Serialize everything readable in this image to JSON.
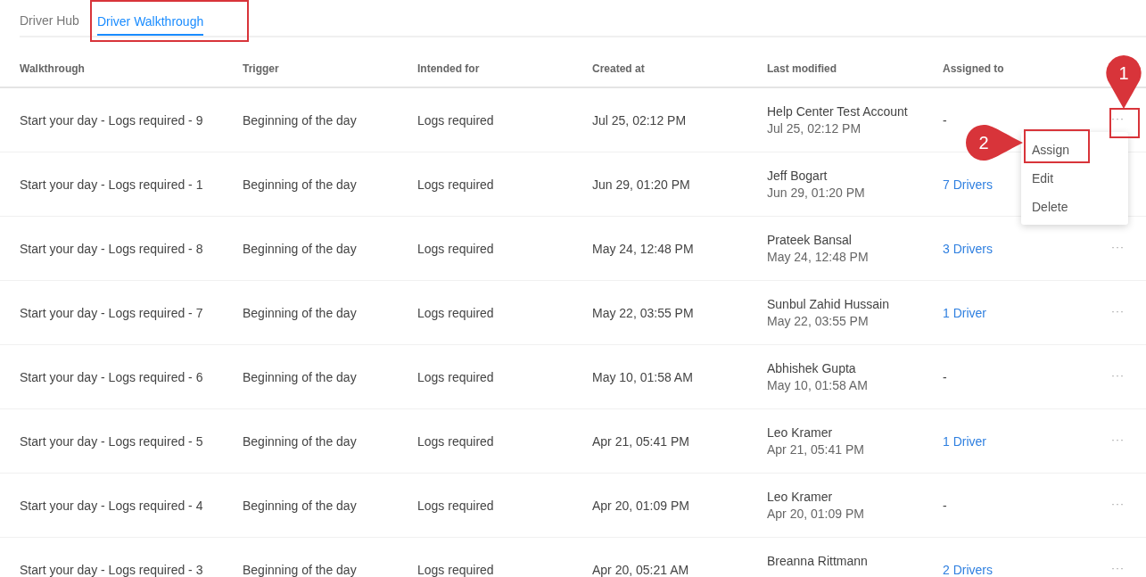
{
  "tabs": [
    {
      "label": "Driver Hub",
      "selected": false
    },
    {
      "label": "Driver Walkthrough",
      "selected": true
    }
  ],
  "table": {
    "columns": [
      "Walkthrough",
      "Trigger",
      "Intended for",
      "Created at",
      "Last modified",
      "Assigned to"
    ],
    "rows": [
      {
        "walkthrough": "Start your day - Logs required - 9",
        "trigger": "Beginning of the day",
        "intended_for": "Logs required",
        "created_at": "Jul 25, 02:12 PM",
        "modified_by": "Help Center Test Account",
        "modified_at": "Jul 25, 02:12 PM",
        "assigned": {
          "kind": "plain",
          "text": "-"
        },
        "actions": "···",
        "menu_open": true
      },
      {
        "walkthrough": "Start your day - Logs required - 1",
        "trigger": "Beginning of the day",
        "intended_for": "Logs required",
        "created_at": "Jun 29, 01:20 PM",
        "modified_by": "Jeff Bogart",
        "modified_at": "Jun 29, 01:20 PM",
        "assigned": {
          "kind": "link",
          "text": "7 Drivers"
        },
        "menu_open": false
      },
      {
        "walkthrough": "Start your day - Logs required - 8",
        "trigger": "Beginning of the day",
        "intended_for": "Logs required",
        "created_at": "May 24, 12:48 PM",
        "modified_by": "Prateek Bansal",
        "modified_at": "May 24, 12:48 PM",
        "assigned": {
          "kind": "link",
          "text": "3 Drivers"
        },
        "actions": "···",
        "menu_open": false
      },
      {
        "walkthrough": "Start your day - Logs required - 7",
        "trigger": "Beginning of the day",
        "intended_for": "Logs required",
        "created_at": "May 22, 03:55 PM",
        "modified_by": "Sunbul Zahid Hussain",
        "modified_at": "May 22, 03:55 PM",
        "assigned": {
          "kind": "link",
          "text": "1 Driver"
        },
        "actions": "···",
        "menu_open": false
      },
      {
        "walkthrough": "Start your day - Logs required - 6",
        "trigger": "Beginning of the day",
        "intended_for": "Logs required",
        "created_at": "May 10, 01:58 AM",
        "modified_by": "Abhishek Gupta",
        "modified_at": "May 10, 01:58 AM",
        "assigned": {
          "kind": "plain",
          "text": "-"
        },
        "actions": "···",
        "menu_open": false
      },
      {
        "walkthrough": "Start your day - Logs required - 5",
        "trigger": "Beginning of the day",
        "intended_for": "Logs required",
        "created_at": "Apr 21, 05:41 PM",
        "modified_by": "Leo Kramer",
        "modified_at": "Apr 21, 05:41 PM",
        "assigned": {
          "kind": "link",
          "text": "1 Driver"
        },
        "actions": "···",
        "menu_open": false
      },
      {
        "walkthrough": "Start your day - Logs required - 4",
        "trigger": "Beginning of the day",
        "intended_for": "Logs required",
        "created_at": "Apr 20, 01:09 PM",
        "modified_by": "Leo Kramer",
        "modified_at": "Apr 20, 01:09 PM",
        "assigned": {
          "kind": "plain",
          "text": "-"
        },
        "actions": "···",
        "menu_open": false
      },
      {
        "walkthrough": "Start your day - Logs required - 3",
        "trigger": "Beginning of the day",
        "intended_for": "Logs required",
        "created_at": "Apr 20, 05:21 AM",
        "modified_by": "Breanna Rittmann",
        "assigned": {
          "kind": "link",
          "text": "2 Drivers"
        },
        "actions": "···",
        "menu_open": false
      }
    ]
  },
  "row_menu": {
    "items": [
      {
        "label": "Assign",
        "highlighted": true
      },
      {
        "label": "Edit",
        "highlighted": false
      },
      {
        "label": "Delete",
        "highlighted": false
      }
    ]
  },
  "annotations": [
    {
      "label": "1"
    },
    {
      "label": "2"
    }
  ]
}
